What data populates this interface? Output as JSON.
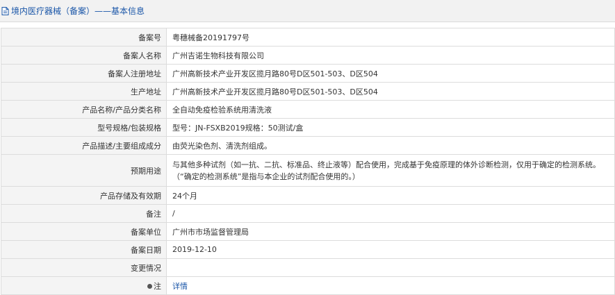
{
  "header": {
    "title": "境内医疗器械（备案）——基本信息"
  },
  "rows": [
    {
      "label": "备案号",
      "value": "粤穗械备20191797号"
    },
    {
      "label": "备案人名称",
      "value": "广州吉诺生物科技有限公司"
    },
    {
      "label": "备案人注册地址",
      "value": "广州高新技术产业开发区揽月路80号D区501-503、D区504"
    },
    {
      "label": "生产地址",
      "value": "广州高新技术产业开发区揽月路80号D区501-503、D区504"
    },
    {
      "label": "产品名称/产品分类名称",
      "value": "全自动免疫检验系统用清洗液"
    },
    {
      "label": "型号规格/包装规格",
      "value": "型号：JN-FSXB2019规格：50测试/盒"
    },
    {
      "label": "产品描述/主要组成成分",
      "value": "由荧光染色剂、清洗剂组成。"
    },
    {
      "label": "预期用途",
      "value": "与其他多种试剂（如一抗、二抗、标准品、终止液等）配合使用，完成基于免疫原理的体外诊断检测，仅用于确定的检测系统。",
      "value2": "（“确定的检测系统”是指与本企业的试剂配合使用的。）"
    },
    {
      "label": "产品存储及有效期",
      "value": "24个月"
    },
    {
      "label": "备注",
      "value": "/"
    },
    {
      "label": "备案单位",
      "value": "广州市市场监督管理局"
    },
    {
      "label": "备案日期",
      "value": "2019-12-10"
    },
    {
      "label": "变更情况",
      "value": ""
    },
    {
      "label": "注",
      "value": "详情"
    }
  ]
}
